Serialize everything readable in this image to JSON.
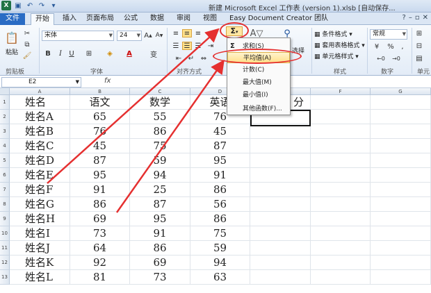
{
  "window": {
    "title": "新建 Microsoft Excel 工作表 (version 1).xlsb [自动保存..."
  },
  "tabs": [
    "文件",
    "开始",
    "插入",
    "页面布局",
    "公式",
    "数据",
    "审阅",
    "视图",
    "Easy Document Creator",
    "团队"
  ],
  "ribbon": {
    "paste": "粘贴",
    "font_name": "宋体",
    "font_size": "24",
    "bold": "B",
    "italic": "I",
    "underline": "U",
    "groups": {
      "clipboard": "剪贴板",
      "font": "字体",
      "align": "对齐方式",
      "style": "样式",
      "number": "数字",
      "cells": "单元"
    },
    "number_format": "常规",
    "styles": [
      "条件格式",
      "套用表格格式",
      "单元格样式"
    ],
    "partial_select": "选择",
    "sigma": "Σ"
  },
  "formula_bar": {
    "name_box": "E2",
    "fx": "fx"
  },
  "columns": [
    "A",
    "B",
    "C",
    "D",
    "E",
    "F",
    "G"
  ],
  "header": [
    "姓名",
    "语文",
    "数学",
    "英语"
  ],
  "partial_e1": "分",
  "rows": [
    [
      "姓名A",
      "65",
      "55",
      "76"
    ],
    [
      "姓名B",
      "76",
      "86",
      "45"
    ],
    [
      "姓名C",
      "45",
      "75",
      "87"
    ],
    [
      "姓名D",
      "87",
      "59",
      "95"
    ],
    [
      "姓名E",
      "95",
      "94",
      "91"
    ],
    [
      "姓名F",
      "91",
      "25",
      "86"
    ],
    [
      "姓名G",
      "86",
      "87",
      "56"
    ],
    [
      "姓名H",
      "69",
      "95",
      "86"
    ],
    [
      "姓名I",
      "73",
      "91",
      "75"
    ],
    [
      "姓名J",
      "64",
      "86",
      "59"
    ],
    [
      "姓名K",
      "92",
      "69",
      "94"
    ],
    [
      "姓名L",
      "81",
      "73",
      "63"
    ]
  ],
  "menu": {
    "items": [
      "求和(S)",
      "平均值(A)",
      "计数(C)",
      "最大值(M)",
      "最小值(I)",
      "其他函数(F)..."
    ],
    "highlighted": "平均值(A)"
  },
  "colors": {
    "accent": "#2a6cc4",
    "annotation": "#e53030",
    "highlight": "#ffe08a"
  }
}
